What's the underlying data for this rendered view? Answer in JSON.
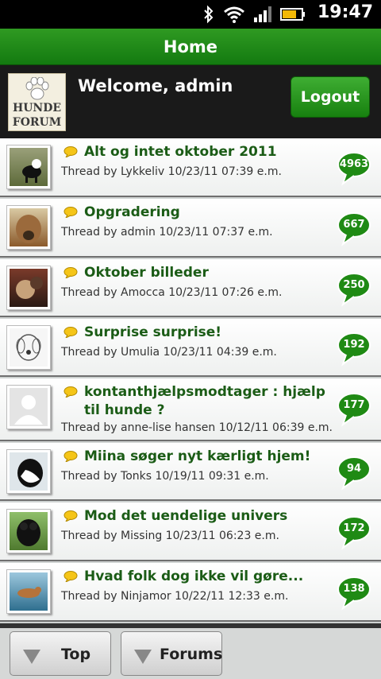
{
  "status_bar": {
    "time": "19:47"
  },
  "header": {
    "title": "Home"
  },
  "welcome": {
    "text": "Welcome, admin",
    "logo_line1": "HUNDE",
    "logo_line2": "FORUM",
    "logout_label": "Logout"
  },
  "threads": [
    {
      "title": "Alt og intet oktober 2011",
      "sub": "Thread by Lykkeliv 10/23/11 07:39 e.m.",
      "count": "4963"
    },
    {
      "title": "Opgradering",
      "sub": "Thread by admin 10/23/11 07:37 e.m.",
      "count": "667"
    },
    {
      "title": "Oktober billeder",
      "sub": "Thread by Amocca 10/23/11 07:26 e.m.",
      "count": "250"
    },
    {
      "title": "Surprise surprise!",
      "sub": "Thread by Umulia 10/23/11 04:39 e.m.",
      "count": "192"
    },
    {
      "title": "kontanthjælpsmodtager : hjælp til hunde ?",
      "sub": "Thread by anne-lise hansen 10/12/11 06:39 e.m.",
      "count": "177"
    },
    {
      "title": "Miina søger nyt kærligt hjem!",
      "sub": "Thread by Tonks 10/19/11 09:31 e.m.",
      "count": "94"
    },
    {
      "title": "Mod det uendelige univers",
      "sub": "Thread by Missing 10/23/11 06:23 e.m.",
      "count": "172"
    },
    {
      "title": "Hvad folk dog ikke vil gøre...",
      "sub": "Thread by Ninjamor 10/22/11 12:33 e.m.",
      "count": "138"
    }
  ],
  "bottom_nav": {
    "top_label": "Top",
    "forums_label": "Forums"
  },
  "colors": {
    "accent_green": "#17800f",
    "title_text": "#1b5c16",
    "bubble_green": "#1f8a14"
  },
  "icons": [
    "bluetooth-icon",
    "wifi-icon",
    "signal-icon",
    "battery-icon",
    "paw-icon",
    "speech-bubble-icon",
    "count-bubble-icon",
    "triangle-down-icon"
  ]
}
